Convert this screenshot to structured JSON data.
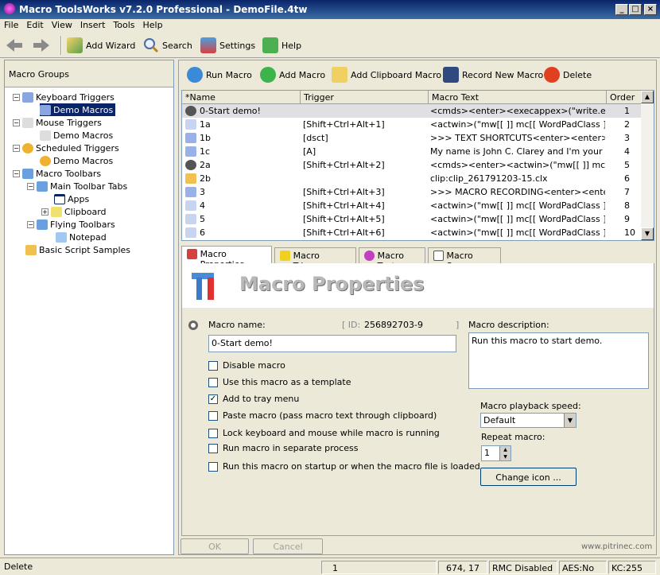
{
  "window": {
    "title": "Macro ToolsWorks v7.2.0 Professional - DemoFile.4tw",
    "min": "_",
    "max": "□",
    "close": "×"
  },
  "menu": [
    "File",
    "Edit",
    "View",
    "Insert",
    "Tools",
    "Help"
  ],
  "toolbar": {
    "add_wizard": "Add Wizard",
    "search": "Search",
    "settings": "Settings",
    "help": "Help"
  },
  "left": {
    "header": "Macro Groups",
    "tree": [
      {
        "label": "Keyboard Triggers",
        "icon": "keyboard-icon"
      },
      {
        "label": "Demo Macros",
        "icon": "folder-icon"
      },
      {
        "label": "Mouse Triggers",
        "icon": "mouse-icon"
      },
      {
        "label": "Demo Macros",
        "icon": "folder-icon"
      },
      {
        "label": "Scheduled Triggers",
        "icon": "clock-icon"
      },
      {
        "label": "Demo Macros",
        "icon": "folder-icon"
      },
      {
        "label": "Macro Toolbars",
        "icon": "toolbar-icon"
      },
      {
        "label": "Main Toolbar Tabs",
        "icon": "toolbar-icon"
      },
      {
        "label": "Apps",
        "icon": "window-icon"
      },
      {
        "label": "Clipboard",
        "icon": "clipboard-icon"
      },
      {
        "label": "Flying Toolbars",
        "icon": "toolbar-icon"
      },
      {
        "label": "Notepad",
        "icon": "notepad-icon"
      },
      {
        "label": "Basic Script Samples",
        "icon": "folder-icon"
      }
    ]
  },
  "actions": {
    "run": "Run Macro",
    "add": "Add Macro",
    "add_clip": "Add Clipboard Macro",
    "record": "Record New Macro",
    "delete": "Delete"
  },
  "list": {
    "columns": [
      "*Name",
      "Trigger",
      "Macro Text",
      "Order"
    ],
    "rows": [
      {
        "name": "0-Start demo!",
        "trigger": "",
        "text": "<cmds><enter><execappex>(\"write.exe\",\"\"...",
        "order": "1"
      },
      {
        "name": "1a",
        "trigger": "[Shift+Ctrl+Alt+1]",
        "text": "<actwin>(\"mw[[  ]] mc[[ WordPadClass ]] cw...",
        "order": "2"
      },
      {
        "name": "1b",
        "trigger": "[dsct]",
        "text": ">>> TEXT SHORTCUTS<enter><enter>Th...",
        "order": "3"
      },
      {
        "name": "1c",
        "trigger": "[A]",
        "text": "My name is John C. Clarey and I'm your con...",
        "order": "4"
      },
      {
        "name": "2a",
        "trigger": "[Shift+Ctrl+Alt+2]",
        "text": "<cmds><enter><actwin>(\"mw[[  ]] mc[[ Wor...",
        "order": "5"
      },
      {
        "name": "2b",
        "trigger": "",
        "text": "clip:clip_261791203-15.clx",
        "order": "6"
      },
      {
        "name": "3",
        "trigger": "[Shift+Ctrl+Alt+3]",
        "text": ">>> MACRO RECORDING<enter><enter>T...",
        "order": "7"
      },
      {
        "name": "4",
        "trigger": "[Shift+Ctrl+Alt+4]",
        "text": "<actwin>(\"mw[[  ]] mc[[ WordPadClass ]] cw...",
        "order": "8"
      },
      {
        "name": "5",
        "trigger": "[Shift+Ctrl+Alt+5]",
        "text": "<actwin>(\"mw[[  ]] mc[[ WordPadClass ]] cw...",
        "order": "9"
      },
      {
        "name": "6",
        "trigger": "[Shift+Ctrl+Alt+6]",
        "text": "<actwin>(\"mw[[  ]] mc[[ WordPadClass ]] cw...",
        "order": "10"
      }
    ]
  },
  "tabs": [
    "Macro Properties",
    "Macro Triggers",
    "Macro Text",
    "Macro Scope"
  ],
  "props": {
    "banner": "Macro Properties",
    "name_label": "Macro name:",
    "id_label": "[ ID:",
    "id_value": "256892703-9",
    "id_close": "]",
    "name_value": "0-Start demo!",
    "desc_label": "Macro description:",
    "desc_value": "Run this macro to start demo.",
    "checks": [
      {
        "label": "Disable macro",
        "checked": false
      },
      {
        "label": "Use this macro as a template",
        "checked": false
      },
      {
        "label": "Add to tray menu",
        "checked": true
      },
      {
        "label": "Paste macro (pass macro text through clipboard)",
        "checked": false
      },
      {
        "label": "Lock keyboard and mouse while macro is running",
        "checked": false
      },
      {
        "label": "Run macro in separate process",
        "checked": false
      },
      {
        "label": "Run this macro on startup or when the macro file is loaded",
        "checked": false
      }
    ],
    "speed_label": "Macro playback speed:",
    "speed_value": "Default",
    "repeat_label": "Repeat macro:",
    "repeat_value": "1",
    "change_icon": "Change icon ..."
  },
  "footer": {
    "ok": "OK",
    "cancel": "Cancel",
    "site": "www.pitrinec.com"
  },
  "status": {
    "left": "Delete",
    "count": "1",
    "pos": "674,  17",
    "rmc": "RMC Disabled",
    "aes": "AES:No",
    "kc": "KC:255"
  }
}
